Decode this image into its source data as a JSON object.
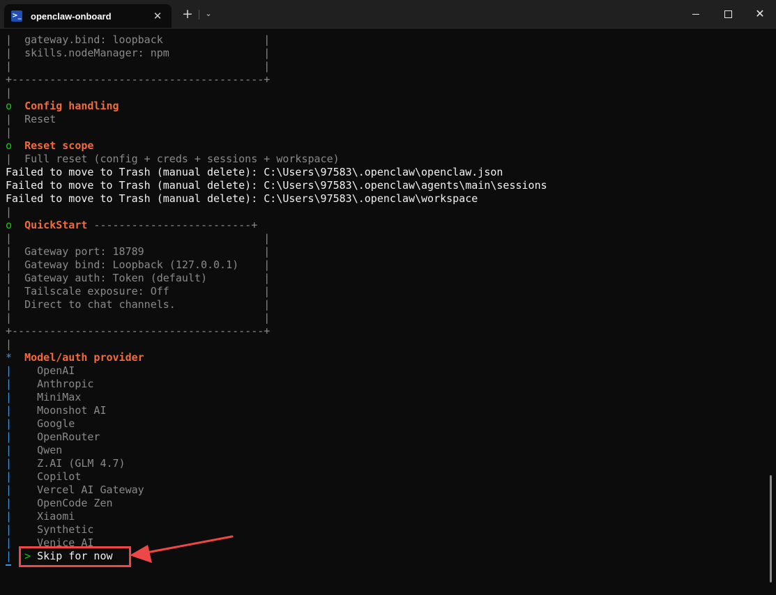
{
  "window": {
    "tab_title": "openclaw-onboard",
    "tab_icon": "powershell-icon",
    "tab_close": "✕",
    "new_tab": "+",
    "dropdown": "⌄",
    "close_symbol": "✕"
  },
  "terminal": {
    "lines": [
      {
        "t": "|  gateway.bind: loopback                |",
        "c": "c-gray"
      },
      {
        "t": "|  skills.nodeManager: npm               |",
        "c": "c-gray"
      },
      {
        "t": "|                                        |",
        "c": "c-gray"
      },
      {
        "t": "+----------------------------------------+",
        "c": "c-gray"
      },
      {
        "t": "|",
        "c": "c-gray"
      },
      {
        "t": "o  ",
        "c": "c-green",
        "label": "Config handling"
      },
      {
        "t": "|  Reset",
        "c": "c-gray"
      },
      {
        "t": "|",
        "c": "c-gray"
      },
      {
        "t": "o  ",
        "c": "c-green",
        "label": "Reset scope"
      },
      {
        "t": "|  Full reset (config + creds + sessions + workspace)",
        "c": "c-gray"
      },
      {
        "t": "Failed to move to Trash (manual delete): C:\\Users\\97583\\.openclaw\\openclaw.json",
        "c": "c-white"
      },
      {
        "t": "Failed to move to Trash (manual delete): C:\\Users\\97583\\.openclaw\\agents\\main\\sessions",
        "c": "c-white"
      },
      {
        "t": "Failed to move to Trash (manual delete): C:\\Users\\97583\\.openclaw\\workspace",
        "c": "c-white"
      },
      {
        "t": "|",
        "c": "c-gray"
      },
      {
        "t": "o  ",
        "c": "c-green",
        "label": "QuickStart",
        "suffix": " -------------------------+"
      },
      {
        "t": "|                                        |",
        "c": "c-gray"
      },
      {
        "t": "|  Gateway port: 18789                   |",
        "c": "c-gray"
      },
      {
        "t": "|  Gateway bind: Loopback (127.0.0.1)    |",
        "c": "c-gray"
      },
      {
        "t": "|  Gateway auth: Token (default)         |",
        "c": "c-gray"
      },
      {
        "t": "|  Tailscale exposure: Off               |",
        "c": "c-gray"
      },
      {
        "t": "|  Direct to chat channels.              |",
        "c": "c-gray"
      },
      {
        "t": "|                                        |",
        "c": "c-gray"
      },
      {
        "t": "+----------------------------------------+",
        "c": "c-gray"
      },
      {
        "t": "|",
        "c": "c-gray"
      },
      {
        "t": "*  ",
        "c": "c-cyan",
        "label": "Model/auth provider"
      }
    ],
    "options": [
      "OpenAI",
      "Anthropic",
      "MiniMax",
      "Moonshot AI",
      "Google",
      "OpenRouter",
      "Qwen",
      "Z.AI (GLM 4.7)",
      "Copilot",
      "Vercel AI Gateway",
      "OpenCode Zen",
      "Xiaomi",
      "Synthetic",
      "Venice AI"
    ],
    "selected_option": "Skip for now",
    "selected_marker": ">"
  },
  "colors": {
    "background": "#0c0c0c",
    "titlebar": "#202020",
    "orange": "#f26b3a",
    "green": "#16c60c",
    "cyan": "#3a96dd",
    "annotation": "#ee4748"
  }
}
